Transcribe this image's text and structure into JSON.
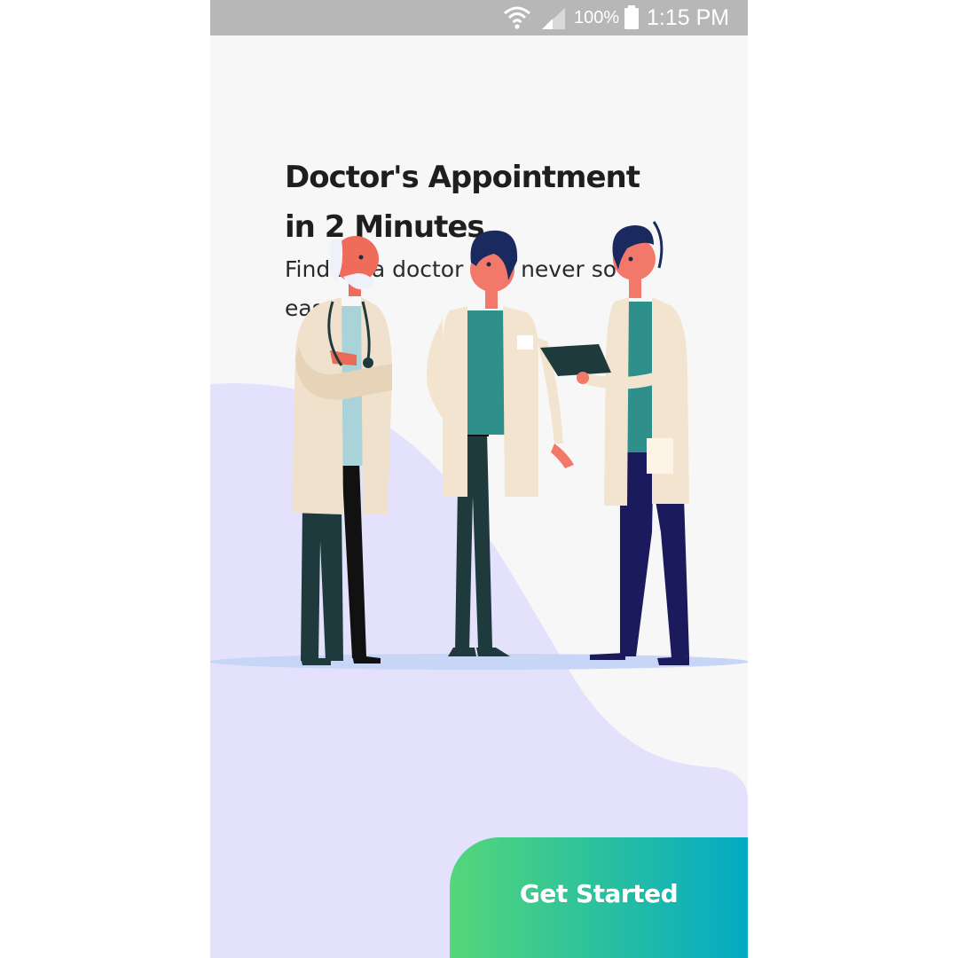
{
  "status_bar": {
    "battery_percent": "100%",
    "time": "1:15 PM",
    "icons": [
      "wifi-icon",
      "signal-icon",
      "battery-icon"
    ]
  },
  "onboarding": {
    "title": "Doctor's Appointment in 2 Minutes",
    "subtitle": "Finding a doctor was never so easy",
    "illustration": "three-doctors-illustration"
  },
  "actions": {
    "get_started_label": "Get Started"
  },
  "colors": {
    "wave": "#e4e1fd",
    "background": "#f7f7f7",
    "button_gradient_start": "#55d67a",
    "button_gradient_end": "#03aac4",
    "status_bar": "#b7b7b7"
  }
}
